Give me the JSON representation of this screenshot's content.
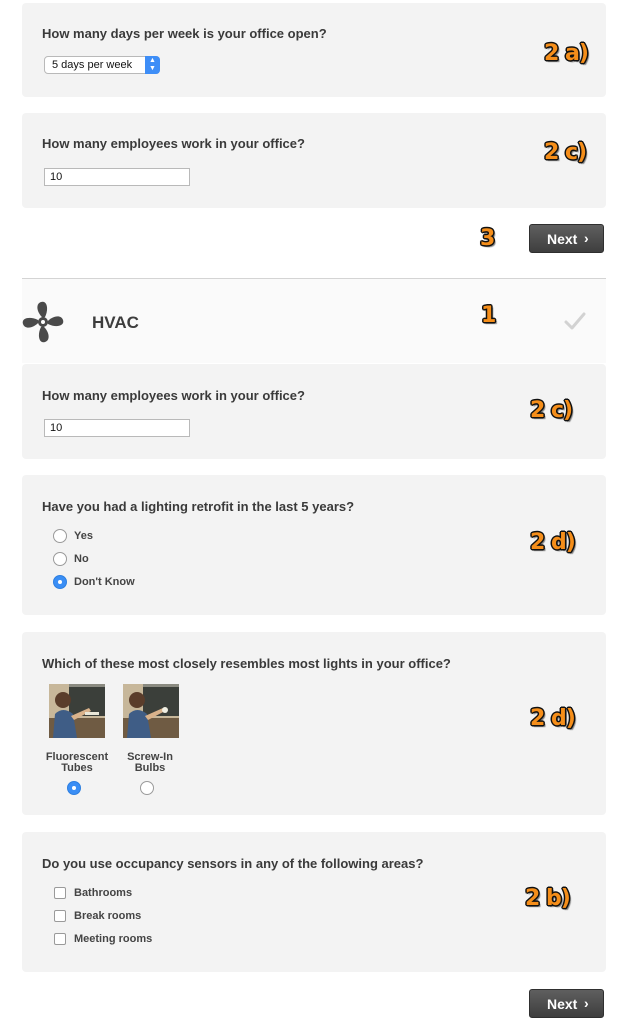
{
  "q_days": {
    "question": "How many days per week is your office open?",
    "select_value": "5 days per week",
    "annotation": "2 a)"
  },
  "q_employees_top": {
    "question": "How many employees work in your office?",
    "value": "10",
    "annotation": "2 c)"
  },
  "next_top": {
    "label": "Next",
    "annotation": "3"
  },
  "hvac": {
    "title": "HVAC",
    "annotation": "1",
    "icon": "fan-icon",
    "status_icon": "checkmark-icon"
  },
  "q_employees_hvac": {
    "question": "How many employees work in your office?",
    "value": "10",
    "annotation": "2 c)"
  },
  "q_retrofit": {
    "question": "Have you had a lighting retrofit in the last 5 years?",
    "options": [
      "Yes",
      "No",
      "Don't Know"
    ],
    "selected": "Don't Know",
    "annotation": "2 d)"
  },
  "q_lights": {
    "question": "Which of these most closely resembles most lights in your office?",
    "options": [
      {
        "line1": "Fluorescent",
        "line2": "Tubes"
      },
      {
        "line1": "Screw-In",
        "line2": "Bulbs"
      }
    ],
    "selected": "Fluorescent Tubes",
    "annotation": "2 d)"
  },
  "q_sensors": {
    "question": "Do you use occupancy sensors in any of the following areas?",
    "options": [
      "Bathrooms",
      "Break rooms",
      "Meeting rooms"
    ],
    "annotation": "2 b)"
  },
  "next_bottom": {
    "label": "Next"
  },
  "colors": {
    "card_bg": "#f3f3f3",
    "annotation": "#f58e1a",
    "accent": "#3a8ef5",
    "button": "#4a4a4a"
  }
}
